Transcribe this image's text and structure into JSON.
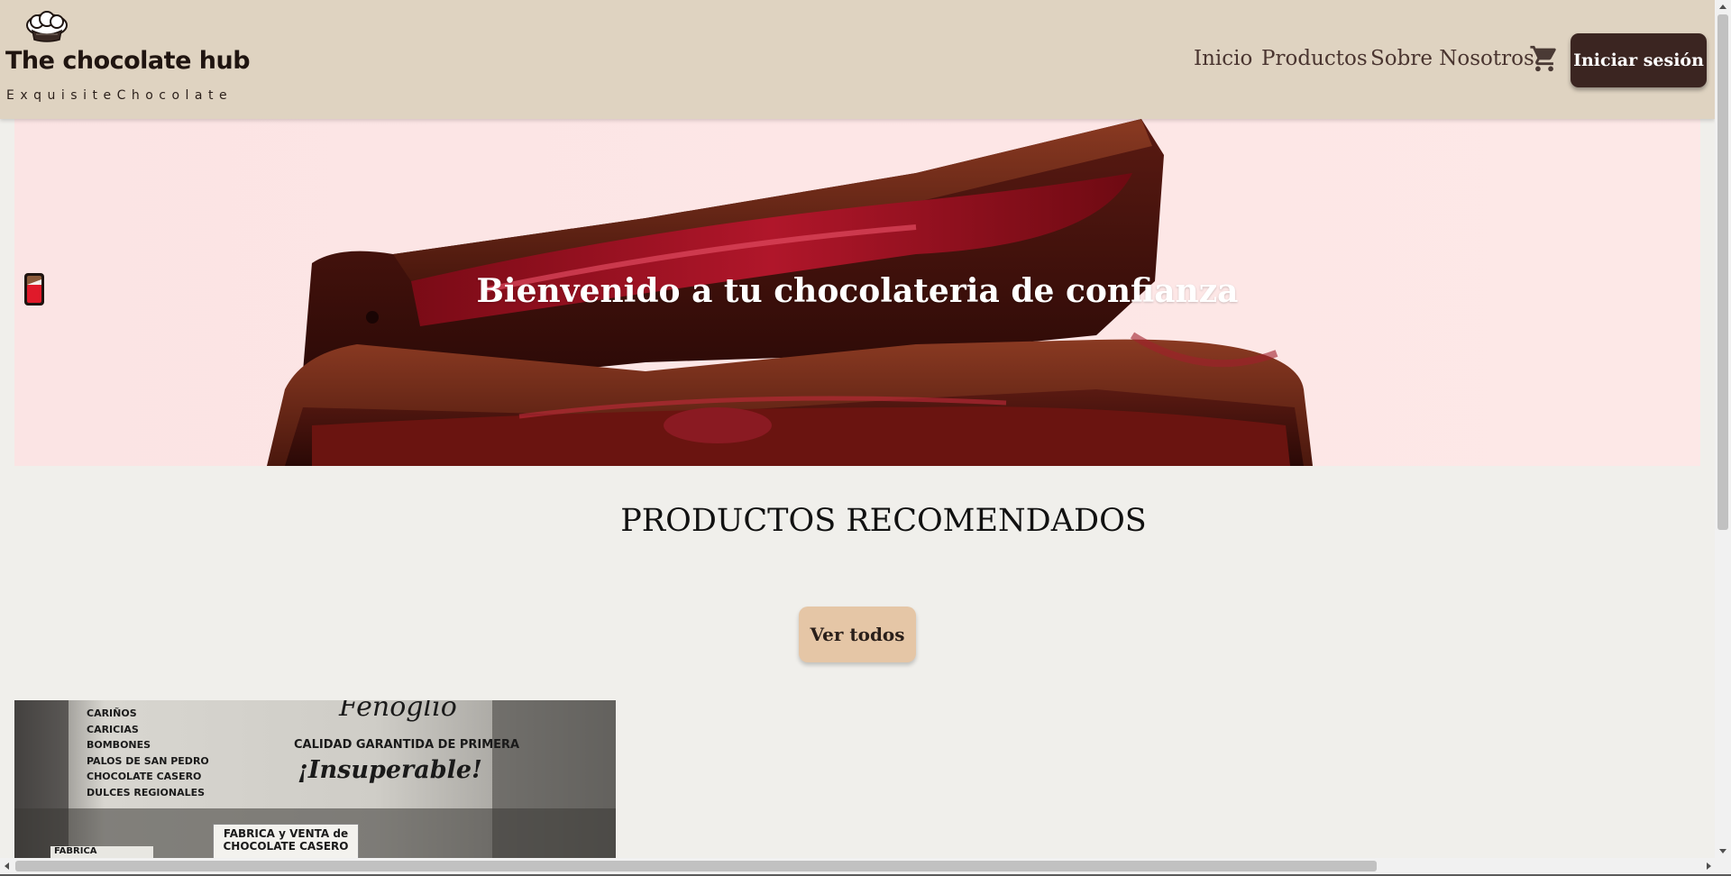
{
  "header": {
    "brand_title": "The chocolate hub",
    "brand_subtitle": "ExquisiteChocolate",
    "nav": {
      "inicio": "Inicio",
      "productos": "Productos",
      "sobre": "Sobre Nosotros"
    },
    "cart_icon": "shopping-cart-icon",
    "logo_icon": "chef-hat-icon",
    "login_label": "Iniciar sesión"
  },
  "hero": {
    "title": "Bienvenido a tu chocolateria de confianza",
    "emoji_icon": "chocolate-bar-icon"
  },
  "section": {
    "title": "PRODUCTOS RECOMENDADOS",
    "see_all_label": "Ver todos"
  },
  "product_card": {
    "sign_list": [
      "CARIÑOS",
      "CARICIAS",
      "BOMBONES",
      "PALOS DE SAN PEDRO",
      "CHOCOLATE CASERO",
      "DULCES REGIONALES"
    ],
    "sign_brand": "Fenoglio",
    "sign_line1": "CALIDAD GARANTIDA DE PRIMERA",
    "sign_line2": "¡Insuperable!",
    "sign_box_line1": "FABRICA y VENTA de",
    "sign_box_line2": "CHOCOLATE CASERO",
    "sign_box_small": "FABRICA"
  },
  "colors": {
    "header_bg": "#dfd3c1",
    "page_bg": "#f0efeb",
    "login_bg": "#3b2521",
    "see_all_bg": "#e5c6a6"
  }
}
